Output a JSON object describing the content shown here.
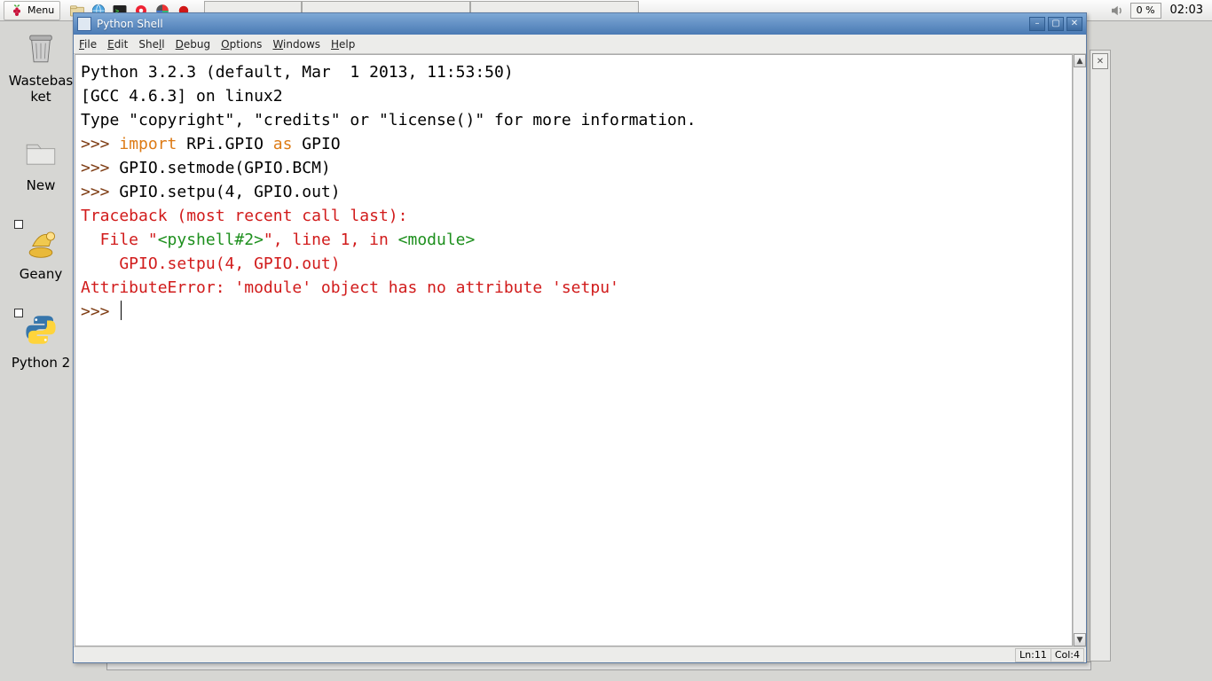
{
  "taskbar": {
    "menu_label": "Menu",
    "cpu_percent": "0 %",
    "clock": "02:03"
  },
  "desktop": {
    "icons": [
      {
        "label": "Wastebasket"
      },
      {
        "label": "New"
      },
      {
        "label": "Geany"
      },
      {
        "label": "Python 2"
      }
    ]
  },
  "window": {
    "title": "Python Shell",
    "min_symbol": "–",
    "max_symbol": "▢",
    "close_symbol": "✕"
  },
  "menubar": {
    "file": "File",
    "edit": "Edit",
    "shell": "Shell",
    "debug": "Debug",
    "options": "Options",
    "windows": "Windows",
    "help": "Help"
  },
  "shell": {
    "banner_line1": "Python 3.2.3 (default, Mar  1 2013, 11:53:50)",
    "banner_line2": "[GCC 4.6.3] on linux2",
    "banner_line3": "Type \"copyright\", \"credits\" or \"license()\" for more information.",
    "prompt": ">>> ",
    "cmd1_import": "import",
    "cmd1_mod": " RPi.GPIO ",
    "cmd1_as": "as",
    "cmd1_alias": " GPIO",
    "cmd2": "GPIO.setmode(GPIO.BCM)",
    "cmd3": "GPIO.setpu(4, GPIO.out)",
    "tb_line1": "Traceback (most recent call last):",
    "tb_line2a": "  File \"",
    "tb_line2b": "<pyshell#2>",
    "tb_line2c": "\", line 1, in ",
    "tb_line2d": "<module>",
    "tb_line3": "    GPIO.setpu(4, GPIO.out)",
    "tb_line4": "AttributeError: 'module' object has no attribute 'setpu'"
  },
  "statusbar": {
    "ln_label": "Ln: ",
    "ln_value": "11",
    "col_label": "Col: ",
    "col_value": "4"
  }
}
